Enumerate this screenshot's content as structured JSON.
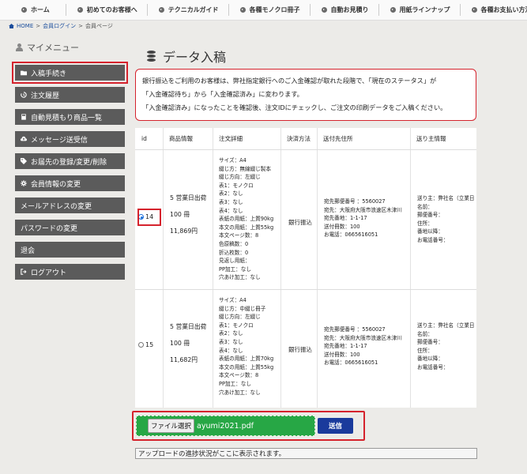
{
  "nav": {
    "items": [
      "ホーム",
      "初めてのお客様へ",
      "テクニカルガイド",
      "各種モノクロ冊子",
      "自動お見積り",
      "用紙ラインナップ",
      "各種お支払い方法"
    ]
  },
  "breadcrumb": {
    "home": "HOME",
    "sep": ">",
    "login": "会員ログイン",
    "current": "会員ページ"
  },
  "sidebar": {
    "title": "マイメニュー",
    "items": [
      {
        "label": "入稿手続き",
        "icon": "folder-icon"
      },
      {
        "label": "注文履歴",
        "icon": "history-icon"
      },
      {
        "label": "自動見積もり商品一覧",
        "icon": "calculator-icon"
      },
      {
        "label": "メッセージ送受信",
        "icon": "cloud-upload-icon"
      },
      {
        "label": "お届先の登録/変更/削除",
        "icon": "tag-icon"
      },
      {
        "label": "会員情報の変更",
        "icon": "gear-icon"
      },
      {
        "label": "メールアドレスの変更",
        "icon": ""
      },
      {
        "label": "パスワードの変更",
        "icon": ""
      },
      {
        "label": "退会",
        "icon": ""
      },
      {
        "label": "ログアウト",
        "icon": "logout-icon"
      }
    ]
  },
  "main": {
    "title": "データ入稿",
    "notice": [
      "銀行振込をご利用のお客様は、弊社指定銀行へのご入金確認が取れた段階で、「現在のステータス」が",
      "「入金確認待ち」から「入金確認済み」に変わります。",
      "「入金確認済み」になったことを確認後、注文IDにチェックし、ご注文の印刷データをご入稿ください。"
    ]
  },
  "table": {
    "headers": [
      "id",
      "商品情報",
      "注文詳細",
      "決済方法",
      "送付先住所",
      "送り主情報"
    ],
    "rows": [
      {
        "id": "14",
        "selected": true,
        "product": [
          "5 営業日出荷",
          "100 冊",
          "11,869円"
        ],
        "details": [
          "サイズ：A4",
          "綴じ方：無線綴じ製本",
          "綴じ方向：左綴じ",
          "表1：モノクロ",
          "表2：なし",
          "表3：なし",
          "表4：なし",
          "表紙の用紙：上質90kg",
          "本文の用紙：上質55kg",
          "本文ページ数：8",
          "色原稿数：0",
          "折込枚数：0",
          "見返し用紙：",
          "PP加工：なし",
          "穴あけ加工：なし"
        ],
        "payment": "銀行振込",
        "address": [
          "宛先郵便番号 ：5560027",
          "宛先：大阪府大阪市浪速区木津川",
          "宛先番地：1-1-17",
          "送付冊数：100",
          "お電話：0665616051"
        ],
        "sender": [
          "送り主：弊社名（立業日",
          "名前：",
          "郵便番号：",
          "住所：",
          "番地以降：",
          "お電話番号："
        ]
      },
      {
        "id": "15",
        "selected": false,
        "product": [
          "5 営業日出荷",
          "100 冊",
          "11,682円"
        ],
        "details": [
          "サイズ：A4",
          "綴じ方：中綴じ冊子",
          "綴じ方向：左綴じ",
          "表1：モノクロ",
          "表2：なし",
          "表3：なし",
          "表4：なし",
          "表紙の用紙：上質70kg",
          "本文の用紙：上質55kg",
          "本文ページ数：8",
          "PP加工：なし",
          "穴あけ加工：なし"
        ],
        "payment": "銀行振込",
        "address": [
          "宛先郵便番号 ：5560027",
          "宛先：大阪府大阪市浪速区木津川",
          "宛先番地：1-1-17",
          "送付冊数：100",
          "お電話：0665616051"
        ],
        "sender": [
          "送り主：弊社名（立業日",
          "名前：",
          "郵便番号：",
          "住所：",
          "番地以降：",
          "お電話番号："
        ]
      }
    ]
  },
  "upload": {
    "file_button": "ファイル選択",
    "file_name": "ayumi2021.pdf",
    "send_button": "送信",
    "progress_text": "アップロードの進捗状況がここに表示されます。"
  },
  "colors": {
    "highlight": "#d5232d",
    "menu_bg": "#5b5b5b",
    "dropzone": "#27a745",
    "send": "#1a3a9c"
  }
}
